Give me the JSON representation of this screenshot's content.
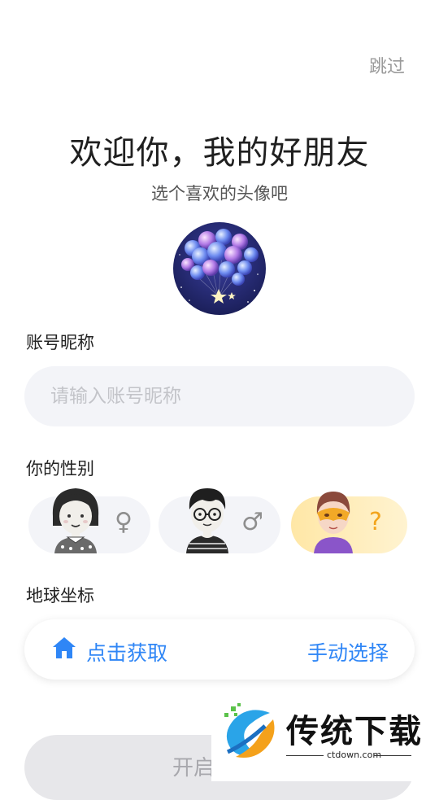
{
  "header": {
    "skip_label": "跳过"
  },
  "welcome": {
    "title": "欢迎你，我的好朋友",
    "subtitle": "选个喜欢的头像吧"
  },
  "nickname": {
    "label": "账号昵称",
    "placeholder": "请输入账号昵称",
    "value": ""
  },
  "gender": {
    "label": "你的性别",
    "options": [
      {
        "name": "female",
        "symbol": "♀",
        "icon": "female-symbol-icon"
      },
      {
        "name": "male",
        "symbol": "♂",
        "icon": "male-symbol-icon"
      },
      {
        "name": "unknown",
        "symbol": "?",
        "icon": "question-mark-icon",
        "selected": true
      }
    ]
  },
  "location": {
    "label": "地球坐标",
    "get_label": "点击获取",
    "manual_label": "手动选择",
    "icon": "home-icon"
  },
  "start_button": {
    "label": "开启"
  },
  "watermark": {
    "text": "传统下载",
    "url": "ctdown.com"
  },
  "colors": {
    "accent": "#2f86f6",
    "input_bg": "#f3f4f8",
    "selected_pill": "#ffe7a6",
    "question": "#f3a51d"
  }
}
